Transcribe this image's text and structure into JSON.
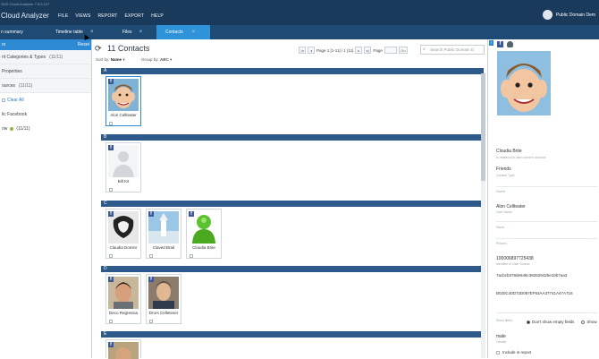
{
  "app": {
    "title": "Cloud Analyzer",
    "version_fragment": "SOS Cloud Analyzer 7.5.0.127"
  },
  "menu": {
    "items": [
      "FILE",
      "VIEWS",
      "REPORT",
      "EXPORT",
      "HELP"
    ]
  },
  "user": {
    "name": "Public Domain Dem"
  },
  "tabs": [
    {
      "label": "n summary"
    },
    {
      "label": "Timeline table"
    },
    {
      "label": "Files"
    },
    {
      "label": "Contacts"
    }
  ],
  "left_panel": {
    "header": "rs",
    "reset": "Reset",
    "rows": [
      {
        "label": "nt Categories & Types",
        "count": "(11/11)"
      },
      {
        "label": "Properties",
        "count": ""
      },
      {
        "label": "ources",
        "count": "(11/11)"
      }
    ],
    "clear_all": "Clear All",
    "source": "lic Facebook",
    "sub_source": "ow",
    "sub_source_count": "(11/11)"
  },
  "main": {
    "title": "11 Contacts",
    "sort_label": "Sort by:",
    "sort_value": "Name",
    "group_label": "Group by:",
    "group_value": "ABC",
    "page_info": "Page 1 [1-11] / 1 [11]",
    "page_label": "Page",
    "go_label": "Go",
    "search_placeholder": "Search Public Domain D",
    "groups": [
      {
        "letter": "A",
        "contacts": [
          {
            "name": "Alon Cellteater",
            "selected": true
          }
        ]
      },
      {
        "letter": "B",
        "contacts": [
          {
            "name": "Bill Kit"
          }
        ]
      },
      {
        "letter": "C",
        "contacts": [
          {
            "name": "Claudia Dominr"
          },
          {
            "name": "Claved Brait"
          },
          {
            "name": "Cloudia Brite"
          }
        ]
      },
      {
        "letter": "D",
        "contacts": [
          {
            "name": "Deco Regressia"
          },
          {
            "name": "Drors Celleteser"
          }
        ]
      },
      {
        "letter": "E",
        "contacts": []
      }
    ]
  },
  "right_panel": {
    "name": "Cloudia Brite",
    "name_sub": "Is related to/is item owner's account",
    "relation": "Friends",
    "relation_sub": "Contact Type",
    "field1_label": "Owner",
    "owner": "Alon Cellteater",
    "owner_sub": "User Name",
    "field2_label": "Name",
    "field3_label": "Phones",
    "id1": "100006897725438",
    "id1_sub": "Identifier in User Source",
    "id2": "7acbcb378de648c38252942be10b7aa3",
    "id2_sub": "",
    "id3": "B020C40D72D087EF63AA37741A47A716",
    "id3_sub": "",
    "show_fields_label": "Show fields:",
    "radio_hide": "Don't show empty fields",
    "radio_show": "Show",
    "gender": "male",
    "gender_sub": "Gender",
    "include_report": "Include in report"
  },
  "colors": {
    "titlebar": "#1a3a5c",
    "tabs": "#1f4a73",
    "active_tab": "#2e93d8",
    "letter_bar": "#2d5a8a",
    "facebook": "#3b5998"
  }
}
